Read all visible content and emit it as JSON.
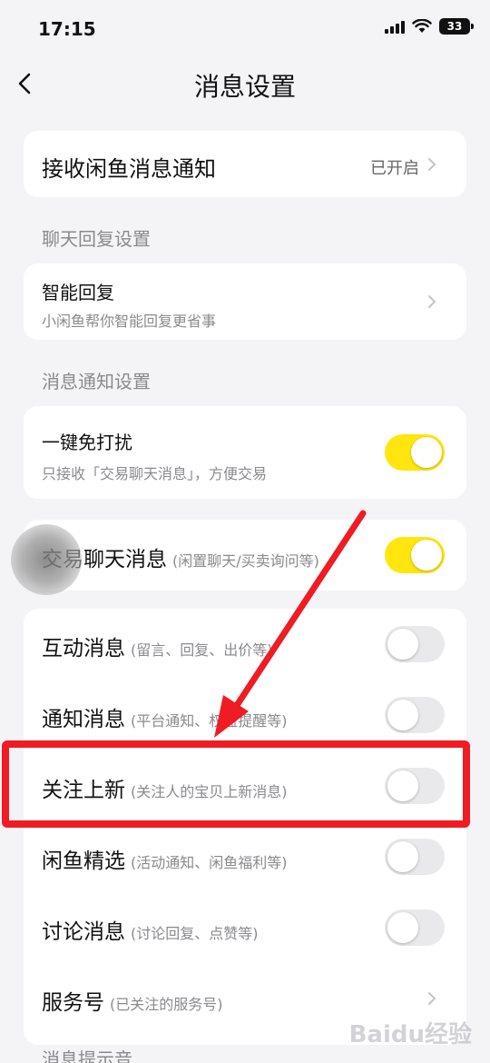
{
  "status_bar": {
    "time": "17:15",
    "battery": "33"
  },
  "nav": {
    "title": "消息设置"
  },
  "receive_notify": {
    "label": "接收闲鱼消息通知",
    "value": "已开启"
  },
  "section_chat_reply": {
    "label": "聊天回复设置"
  },
  "smart_reply": {
    "title": "智能回复",
    "subtitle": "小闲鱼帮你智能回复更省事"
  },
  "section_notify": {
    "label": "消息通知设置"
  },
  "dnd": {
    "title": "一键免打扰",
    "subtitle": "只接收「交易聊天消息」，方便交易",
    "on": true
  },
  "trade_chat": {
    "title": "交易聊天消息",
    "hint": "(闲置聊天/买卖询问等)",
    "on": true
  },
  "list": [
    {
      "title": "互动消息",
      "hint": "(留言、回复、出价等)",
      "on": false
    },
    {
      "title": "通知消息",
      "hint": "(平台通知、权益提醒等)",
      "on": false
    },
    {
      "title": "关注上新",
      "hint": "(关注人的宝贝上新消息)",
      "on": false
    },
    {
      "title": "闲鱼精选",
      "hint": "(活动通知、闲鱼福利等)",
      "on": false
    },
    {
      "title": "讨论消息",
      "hint": "(讨论回复、点赞等)",
      "on": false
    }
  ],
  "service": {
    "title": "服务号",
    "hint": "(已关注的服务号)"
  },
  "section_sound": {
    "label": "消息提示音"
  },
  "watermark": "Baidu经验",
  "colors": {
    "toggle_on": "#ffe60f",
    "highlight": "#ef1c24",
    "background": "#f4f3f6"
  }
}
